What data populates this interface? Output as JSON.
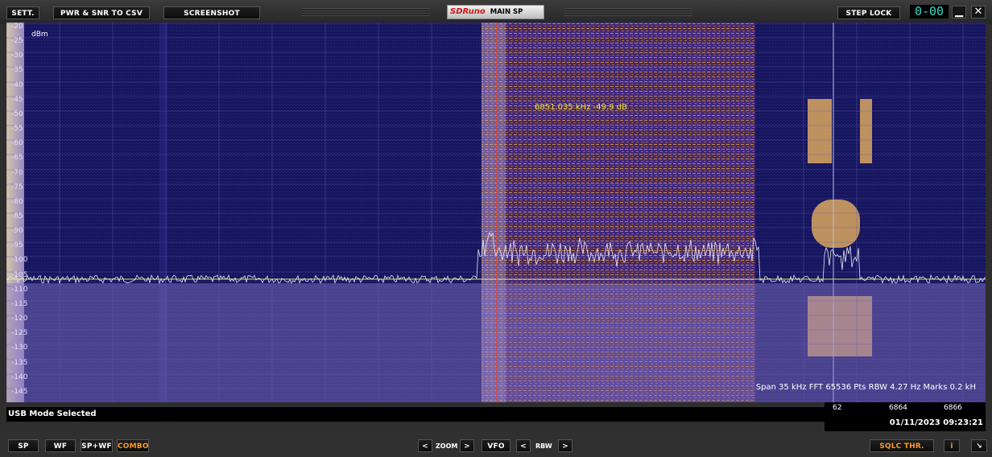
{
  "toolbar": {
    "settings": "SETT.",
    "pwr_snr": "PWR & SNR TO CSV",
    "screenshot": "SCREENSHOT",
    "logo_brand": "SDRuno",
    "logo_title": "MAIN SP",
    "step_lock": "STEP LOCK",
    "lcd": "0-00",
    "minimize": "▁",
    "close": "✕"
  },
  "spectrum": {
    "unit": "dBm",
    "y_ticks": [
      "-20",
      "-25",
      "-30",
      "-35",
      "-40",
      "-45",
      "-50",
      "-55",
      "-60",
      "-65",
      "-70",
      "-75",
      "-80",
      "-85",
      "-90",
      "-95",
      "-100",
      "-105",
      "-110",
      "-115",
      "-120",
      "-125",
      "-130",
      "-135",
      "-140",
      "-145"
    ],
    "cursor_readout": "6851.035 kHz -49.9 dB",
    "info_line": "Span 35 kHz   FFT 65536 Pts   RBW 4.27 Hz   Marks 0.2 kH",
    "x_labels": [
      "62",
      "6864",
      "6866"
    ],
    "noise_floor_db": -100,
    "colors": {
      "background": "#12125a",
      "trace": "#e8e8f0",
      "floor_line": "#e0e060",
      "cursor": "#e04020"
    }
  },
  "status_text": "USB Mode Selected",
  "datetime": "01/11/2023 09:23:21",
  "bottom": {
    "sp": "SP",
    "wf": "WF",
    "spwf": "SP+WF",
    "combo": "COMBO",
    "zoom_left": "<",
    "zoom": "ZOOM",
    "zoom_right": ">",
    "vfo": "VFO",
    "rbw_left": "<",
    "rbw": "RBW",
    "rbw_right": ">",
    "sqlc": "SQLC THR.",
    "info": "i",
    "resize": "↘"
  }
}
